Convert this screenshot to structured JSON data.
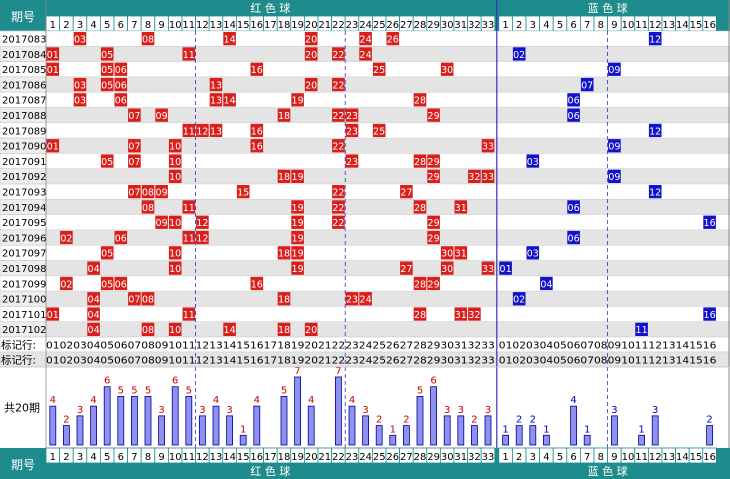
{
  "header": {
    "period_label": "期号",
    "red_title": "红 色 球",
    "blue_title": "蓝 色 球"
  },
  "red_numbers": [
    1,
    2,
    3,
    4,
    5,
    6,
    7,
    8,
    9,
    10,
    11,
    12,
    13,
    14,
    15,
    16,
    17,
    18,
    19,
    20,
    21,
    22,
    23,
    24,
    25,
    26,
    27,
    28,
    29,
    30,
    31,
    32,
    33
  ],
  "blue_numbers": [
    1,
    2,
    3,
    4,
    5,
    6,
    7,
    8,
    9,
    10,
    11,
    12,
    13,
    14,
    15,
    16
  ],
  "draws": [
    {
      "period": "2017083",
      "red": [
        3,
        8,
        14,
        20,
        24,
        26
      ],
      "blue": 12
    },
    {
      "period": "2017084",
      "red": [
        1,
        5,
        11,
        20,
        22,
        24
      ],
      "blue": 2
    },
    {
      "period": "2017085",
      "red": [
        1,
        5,
        6,
        16,
        25,
        30
      ],
      "blue": 9
    },
    {
      "period": "2017086",
      "red": [
        3,
        5,
        6,
        13,
        20,
        22
      ],
      "blue": 7
    },
    {
      "period": "2017087",
      "red": [
        3,
        6,
        13,
        14,
        19,
        28
      ],
      "blue": 6
    },
    {
      "period": "2017088",
      "red": [
        7,
        9,
        18,
        22,
        23,
        29
      ],
      "blue": 6
    },
    {
      "period": "2017089",
      "red": [
        11,
        12,
        13,
        16,
        23,
        25
      ],
      "blue": 12
    },
    {
      "period": "2017090",
      "red": [
        1,
        7,
        10,
        16,
        22,
        33
      ],
      "blue": 9
    },
    {
      "period": "2017091",
      "red": [
        5,
        7,
        10,
        23,
        28,
        29
      ],
      "blue": 3
    },
    {
      "period": "2017092",
      "red": [
        10,
        18,
        19,
        29,
        32,
        33
      ],
      "blue": 9
    },
    {
      "period": "2017093",
      "red": [
        7,
        8,
        9,
        15,
        22,
        27
      ],
      "blue": 12
    },
    {
      "period": "2017094",
      "red": [
        8,
        11,
        19,
        22,
        28,
        31
      ],
      "blue": 6
    },
    {
      "period": "2017095",
      "red": [
        9,
        10,
        12,
        19,
        22,
        29
      ],
      "blue": 16
    },
    {
      "period": "2017096",
      "red": [
        2,
        6,
        11,
        12,
        19,
        29
      ],
      "blue": 6
    },
    {
      "period": "2017097",
      "red": [
        5,
        10,
        18,
        19,
        30,
        31
      ],
      "blue": 3
    },
    {
      "period": "2017098",
      "red": [
        4,
        10,
        19,
        27,
        30,
        33
      ],
      "blue": 1
    },
    {
      "period": "2017099",
      "red": [
        2,
        5,
        6,
        16,
        28,
        29
      ],
      "blue": 4
    },
    {
      "period": "2017100",
      "red": [
        4,
        7,
        8,
        18,
        23,
        24
      ],
      "blue": 2
    },
    {
      "period": "2017101",
      "red": [
        1,
        4,
        11,
        28,
        31,
        32
      ],
      "blue": 16
    },
    {
      "period": "2017102",
      "red": [
        4,
        8,
        10,
        14,
        18,
        20
      ],
      "blue": 11
    }
  ],
  "marker_rows": [
    {
      "label": "标记行:",
      "red_text": "010203040506070809101112131415161718192021222324252627282930313233",
      "blue_text": "01020304050607080910111213141516"
    },
    {
      "label": "标记行:",
      "red_text": "010203040506070809101112131415161718192021222324252627282930313233",
      "blue_text": "01020304050607080910111213141516"
    }
  ],
  "chart_data": {
    "type": "bar",
    "title": "共20期",
    "series": [
      {
        "name": "红色球",
        "categories": [
          1,
          2,
          3,
          4,
          5,
          6,
          7,
          8,
          9,
          10,
          11,
          12,
          13,
          14,
          15,
          16,
          17,
          18,
          19,
          20,
          21,
          22,
          23,
          24,
          25,
          26,
          27,
          28,
          29,
          30,
          31,
          32,
          33
        ],
        "values": [
          4,
          2,
          3,
          4,
          6,
          5,
          5,
          5,
          3,
          6,
          5,
          3,
          4,
          3,
          1,
          4,
          0,
          5,
          7,
          4,
          0,
          7,
          4,
          3,
          2,
          1,
          2,
          5,
          6,
          3,
          3,
          2,
          3
        ]
      },
      {
        "name": "蓝色球",
        "categories": [
          1,
          2,
          3,
          4,
          5,
          6,
          7,
          8,
          9,
          10,
          11,
          12,
          13,
          14,
          15,
          16
        ],
        "values": [
          1,
          2,
          2,
          1,
          0,
          4,
          1,
          0,
          3,
          0,
          1,
          3,
          0,
          0,
          0,
          2
        ]
      }
    ]
  },
  "colors": {
    "header_bg": "#1e8c8c",
    "red_ball": "#d7201c",
    "blue_ball": "#1212c8",
    "red_text_label": "#cc0000",
    "blue_text_label": "#0000cc",
    "grid": "#c8c8c8",
    "stripe": "#e4e4e4",
    "bar_fill": "#9090ee",
    "bar_stroke": "#000099",
    "divider": "#3030c0"
  }
}
